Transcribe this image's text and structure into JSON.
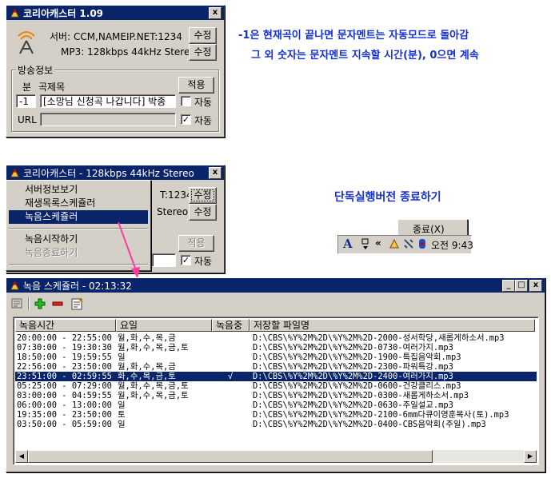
{
  "notes": {
    "line1": "-1은 현재곡이 끝나면 문자멘트는 자동모드로 돌아감",
    "line2": "그 외 숫자는 문자멘트 지속할 시간(분), 0으면 계속",
    "exit_label": "단독실행버전 종료하기"
  },
  "win1": {
    "title": "코리아캐스터 1.09",
    "close": "x",
    "server_label": "서버: CCM,NAMEIP.NET:1234",
    "edit1": "수정",
    "mp3_label": "MP3: 128kbps 44kHz Stereo",
    "edit2": "수정",
    "group_title": "방송정보",
    "col_min": "분",
    "col_title": "곡제목",
    "apply": "적용",
    "minutes_value": "-1",
    "title_value": "[소망님 신청곡 나갑니다] 박종",
    "auto1": "자동",
    "url_label": "URL",
    "url_value": "",
    "auto2": "자동"
  },
  "win2": {
    "title": "코리아캐스터 - 128kbps 44kHz Stereo",
    "close": "x",
    "server_tail": "T:1234",
    "edit1": "수정",
    "stereo_tail": "Stereo",
    "edit2": "수정",
    "apply": "적용",
    "auto": "자동",
    "menu": [
      {
        "label": "서버정보보기"
      },
      {
        "label": "재생목록스케쥴러"
      },
      {
        "label": "녹음스케쥴러"
      },
      {
        "label": "녹음시작하기"
      },
      {
        "label": "녹음종료하기"
      }
    ]
  },
  "tray": {
    "popup": "종료(X)",
    "font_glyph": "A",
    "chevron": "«",
    "time": "오전 9:43"
  },
  "win3": {
    "title": "녹음 스케쥴러 - 02:13:32",
    "min": "_",
    "max": "□",
    "close": "x",
    "headers": {
      "time": "녹음시간",
      "day": "요일",
      "rec": "녹음중",
      "file": "저장할 파일명"
    },
    "rows": [
      {
        "time": "20:00:00 - 22:55:00",
        "day": "월,화,수,목,금",
        "rec": "",
        "file": "D:\\CBS\\%Y%2M%2D\\%Y%2M%2D-2000-성서학당,새롭게하소서.mp3"
      },
      {
        "time": "07:30:00 - 19:30:30",
        "day": "월,화,수,목,금,토",
        "rec": "",
        "file": "D:\\CBS\\%Y%2M%2D\\%Y%2M%2D-0730-여러가지.mp3"
      },
      {
        "time": "18:50:00 - 19:59:55",
        "day": "일",
        "rec": "",
        "file": "D:\\CBS\\%Y%2M%2D\\%Y%2M%2D-1900-특집음악회.mp3"
      },
      {
        "time": "22:56:00 - 23:50:00",
        "day": "월,화,수,목,금",
        "rec": "",
        "file": "D:\\CBS\\%Y%2M%2D\\%Y%2M%2D-2300-파워특강.mp3"
      },
      {
        "time": "23:51:00 - 02:59:55",
        "day": "화,수,목,금,토",
        "rec": "√",
        "file": "D:\\CBS\\%Y%2M%2D\\%Y%2M%2D-2400-여러가지.mp3"
      },
      {
        "time": "05:25:00 - 07:29:00",
        "day": "월,화,수,목,금,토",
        "rec": "",
        "file": "D:\\CBS\\%Y%2M%2D\\%Y%2M%2D-0600-건강클리스.mp3"
      },
      {
        "time": "03:00:00 - 04:59:55",
        "day": "월,화,수,목,금,토",
        "rec": "",
        "file": "D:\\CBS\\%Y%2M%2D\\%Y%2M%2D-0300-새롭게하소서.mp3"
      },
      {
        "time": "06:00:00 - 13:00:00",
        "day": "일",
        "rec": "",
        "file": "D:\\CBS\\%Y%2M%2D\\%Y%2M%2D-0630-주일설교.mp3"
      },
      {
        "time": "19:35:00 - 23:50:00",
        "day": "토",
        "rec": "",
        "file": "D:\\CBS\\%Y%2M%2D\\%Y%2M%2D-2100-6mm다큐이영훈목사(토).mp3"
      },
      {
        "time": "03:50:00 - 05:59:00",
        "day": "일",
        "rec": "",
        "file": "D:\\CBS\\%Y%2M%2D\\%Y%2M%2D-0400-CBS음악회(주일).mp3"
      }
    ],
    "selected_row": 4
  },
  "colors": {
    "titlebar": "#0a246a",
    "note": "#1430d0",
    "arrow": "#ff3ca0"
  }
}
